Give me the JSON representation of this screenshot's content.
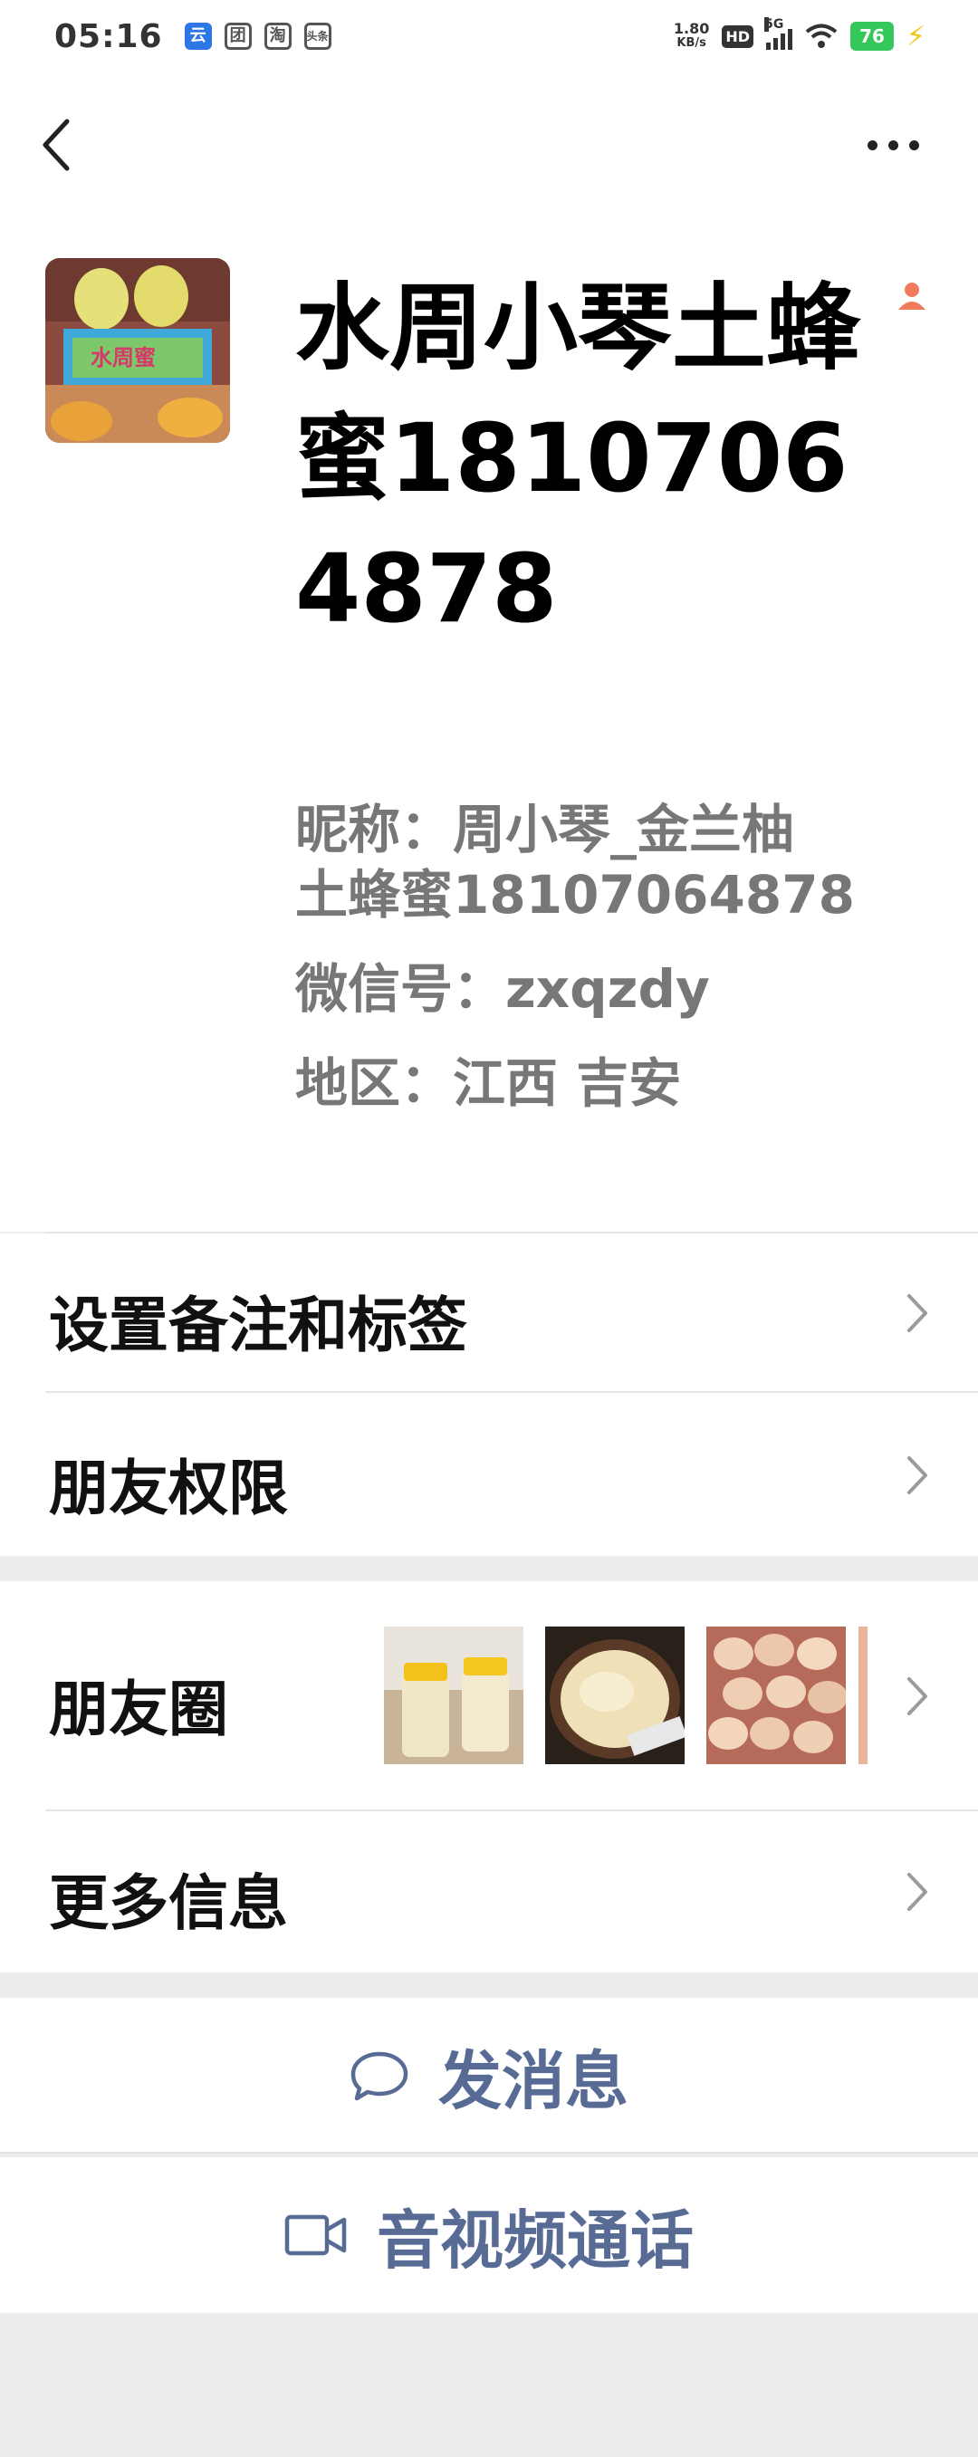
{
  "status_bar": {
    "time": "05:16",
    "app_icons": [
      {
        "name": "cloud-app-icon",
        "glyph": "云",
        "blue": true
      },
      {
        "name": "tuan-app-icon",
        "glyph": "团",
        "blue": false
      },
      {
        "name": "taobao-app-icon",
        "glyph": "淘",
        "blue": false
      },
      {
        "name": "toutiao-app-icon",
        "glyph": "头条",
        "blue": false
      }
    ],
    "net_speed_value": "1.80",
    "net_speed_unit": "KB/s",
    "hd_label": "HD",
    "network_type": "5G",
    "battery": "76",
    "battery_color": "#34c759"
  },
  "profile": {
    "name": "水周小琴土蜂蜜18107064878",
    "nickname_line1": "昵称：周小琴_金兰柚",
    "nickname_line2": "土蜂蜜18107064878",
    "wechat_id": "微信号：zxqzdy",
    "region": "地区：江西  吉安"
  },
  "menu": {
    "remark_tags": "设置备注和标签",
    "friend_permissions": "朋友权限",
    "moments": "朋友圈",
    "more_info": "更多信息"
  },
  "actions": {
    "send_message": "发消息",
    "video_call": "音视频通话"
  },
  "colors": {
    "link": "#576b95",
    "divider": "#e5e5e5",
    "background": "#ededed"
  }
}
